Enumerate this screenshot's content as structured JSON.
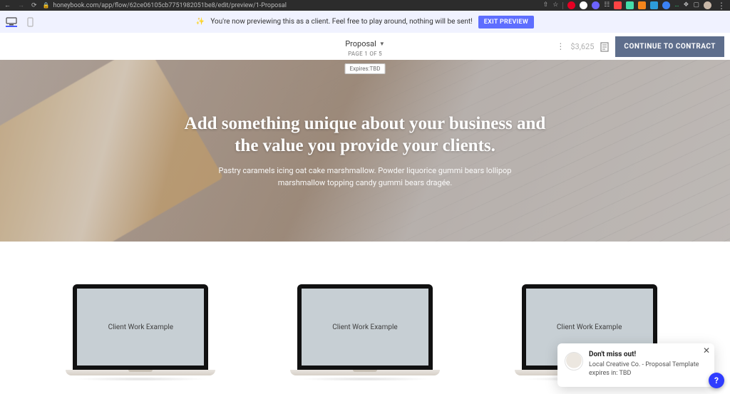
{
  "browser": {
    "url": "honeybook.com/app/flow/62ce06105cb7751982051be8/edit/preview/1-Proposal",
    "extensions": [
      {
        "name": "share-icon",
        "color": "#b8b8b8",
        "shape": "box"
      },
      {
        "name": "star-icon",
        "color": "#b8b8b8",
        "shape": "star"
      },
      {
        "name": "pinterest-ext",
        "color": "#e60023",
        "shape": "round"
      },
      {
        "name": "grammarly-ext",
        "color": "#ffffff",
        "shape": "round"
      },
      {
        "name": "loom-ext",
        "color": "#6c63ff",
        "shape": "round"
      },
      {
        "name": "grid-ext",
        "color": "#b8b8b8",
        "shape": "box"
      },
      {
        "name": "colorzilla-ext",
        "color": "#ff4444",
        "shape": "box"
      },
      {
        "name": "react-ext",
        "color": "#44ddaa",
        "shape": "box"
      },
      {
        "name": "metamask-ext",
        "color": "#f6851b",
        "shape": "box"
      },
      {
        "name": "dashlane-ext",
        "color": "#2d9cdb",
        "shape": "box"
      },
      {
        "name": "chat-ext",
        "color": "#3b82f6",
        "shape": "round"
      },
      {
        "name": "more-ext-icon",
        "color": "#2ecc71",
        "shape": "dots"
      },
      {
        "name": "puzzle-icon",
        "color": "#b8b8b8",
        "shape": "box"
      },
      {
        "name": "panel-icon",
        "color": "#b8b8b8",
        "shape": "box"
      },
      {
        "name": "profile-avatar",
        "color": "#c9b8a8",
        "shape": "round"
      }
    ]
  },
  "banner": {
    "message": "You're now previewing this as a client. Feel free to play around, nothing will be sent!",
    "exit_label": "EXIT PREVIEW"
  },
  "toolbar": {
    "doc_title": "Proposal",
    "page_indicator": "PAGE 1 OF 5",
    "expires_badge": "Expires:TBD",
    "price": "$3,625",
    "cta_label": "CONTINUE TO CONTRACT"
  },
  "hero": {
    "heading": "Add something unique about your business and the value you provide your clients.",
    "subheading": "Pastry caramels icing oat cake marshmallow. Powder liquorice gummi bears lollipop marshmallow topping candy gummi bears dragée."
  },
  "portfolio": {
    "items": [
      {
        "label": "Client Work Example"
      },
      {
        "label": "Client Work Example"
      },
      {
        "label": "Client Work Example"
      }
    ]
  },
  "toast": {
    "title": "Don't miss out!",
    "message": "Local Creative Co. - Proposal Template expires in: TBD"
  },
  "help": {
    "label": "?"
  }
}
